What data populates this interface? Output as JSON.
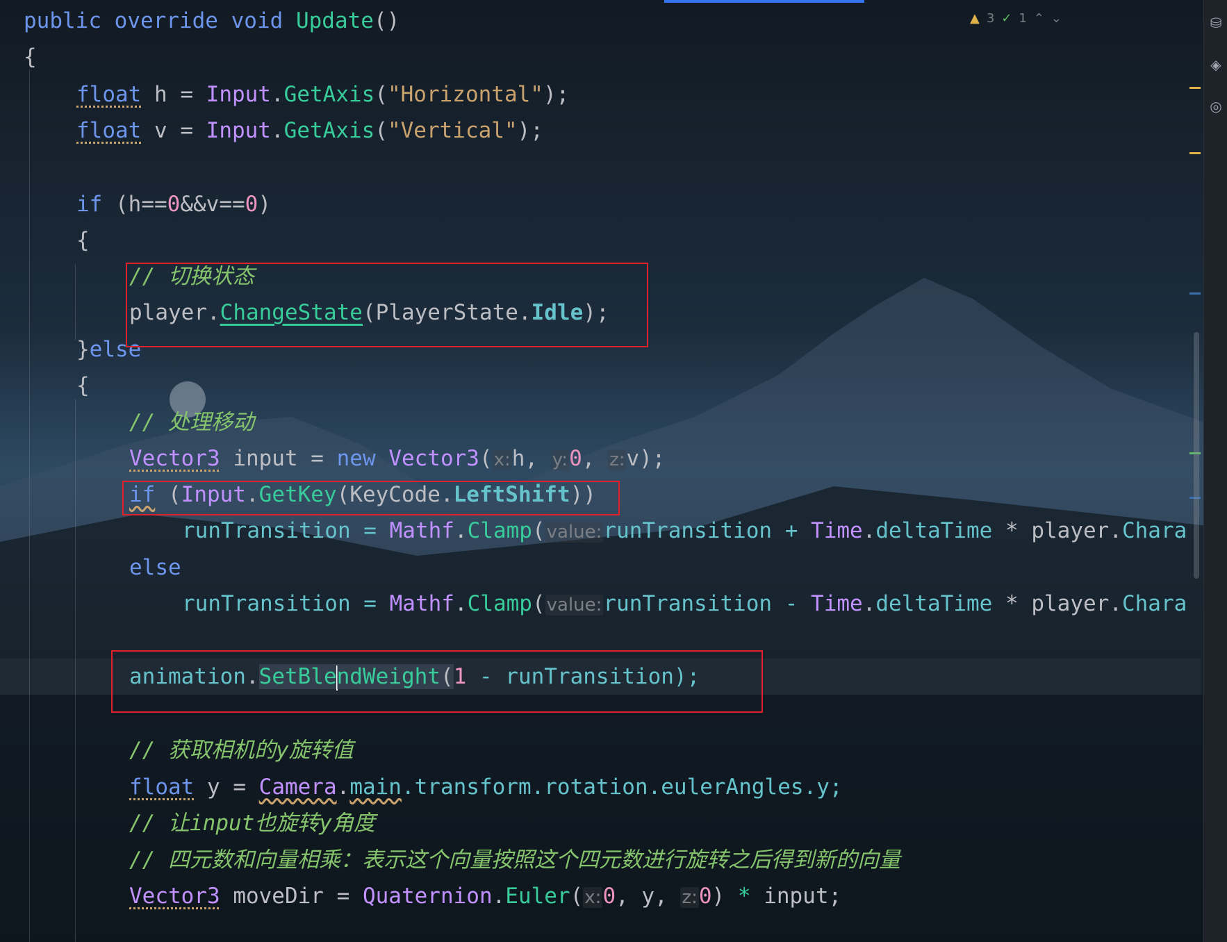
{
  "status": {
    "warnings": "3",
    "ok_count": "1",
    "up_arrow": "⌃",
    "down_arrow": "⌄"
  },
  "toolbar": {
    "icons": [
      "database-icon",
      "puzzle-icon",
      "coverage-icon"
    ]
  },
  "colors": {
    "highlight_box": "#e0202a",
    "keyword": "#6c95eb",
    "method": "#39cc9b",
    "comment": "#85c46c",
    "string": "#c9a26d",
    "number": "#ed94c0",
    "type": "#c191ff"
  },
  "code": {
    "l1_public": "public",
    "l1_override": "override",
    "l1_void": "void",
    "l1_name": "Update",
    "l1_parens": "()",
    "l2_brace": "{",
    "l3_float": "float",
    "l3_rest": " h = ",
    "l3_input": "Input",
    "l3_dot": ".",
    "l3_getaxis": "GetAxis",
    "l3_open": "(",
    "l3_str": "\"Horizontal\"",
    "l3_close": ");",
    "l4_float": "float",
    "l4_rest": " v = ",
    "l4_input": "Input",
    "l4_dot": ".",
    "l4_getaxis": "GetAxis",
    "l4_open": "(",
    "l4_str": "\"Vertical\"",
    "l4_close": ");",
    "l5_if": "if",
    "l5_a": " (h==",
    "l5_n1": "0",
    "l5_b": "&&v==",
    "l5_n2": "0",
    "l5_c": ")",
    "l6_brace": "{",
    "l7_comment": "// 切换状态",
    "l8_player": "player",
    "l8_dot": ".",
    "l8_method": "ChangeState",
    "l8_open": "(",
    "l8_enum": "PlayerState",
    "l8_dot2": ".",
    "l8_val": "Idle",
    "l8_close": ");",
    "l9_brace": "}",
    "l9_else": "else",
    "l10_brace": "{",
    "l11_comment": "// 处理移动",
    "l12_vec": "Vector3",
    "l12_a": " input = ",
    "l12_new": "new",
    "l12_sp": " ",
    "l12_vec2": "Vector3",
    "l12_open": "(",
    "l12_hx": "x:",
    "l12_h": "h, ",
    "l12_hy": "y:",
    "l12_zero": "0",
    "l12_comma": ", ",
    "l12_hz": "z:",
    "l12_v": "v);",
    "l13_if": "if",
    "l13_a": " (",
    "l13_input": "Input",
    "l13_dot": ".",
    "l13_getkey": "GetKey",
    "l13_open": "(",
    "l13_keycode": "KeyCode",
    "l13_dot2": ".",
    "l13_lshift": "LeftShift",
    "l13_close": "))",
    "l14_rt": "runTransition = ",
    "l14_mathf": "Mathf",
    "l14_dot": ".",
    "l14_clamp": "Clamp",
    "l14_open": "(",
    "l14_hint": "value:",
    "l14_rt2": "runTransition + ",
    "l14_time": "Time",
    "l14_dot2": ".",
    "l14_dt": "deltaTime",
    "l14_mul": " * player.",
    "l14_chara": "Chara",
    "l15_else": "else",
    "l16_rt": "runTransition = ",
    "l16_mathf": "Mathf",
    "l16_dot": ".",
    "l16_clamp": "Clamp",
    "l16_open": "(",
    "l16_hint": "value:",
    "l16_rt2": "runTransition - ",
    "l16_time": "Time",
    "l16_dot2": ".",
    "l16_dt": "deltaTime",
    "l16_mul": " * player.",
    "l16_chara": "Chara",
    "l17_anim": "animation",
    "l17_dot": ".",
    "l17_m1": "SetBle",
    "l17_m2": "ndWeight",
    "l17_open": "(",
    "l17_one": "1",
    "l17_rest": " - runTransition);",
    "l18_comment": "// 获取相机的y旋转值",
    "l19_float": "float",
    "l19_a": " y = ",
    "l19_camera": "Camera",
    "l19_dot": ".",
    "l19_main": "main",
    "l19_rest": ".transform.rotation.eulerAngles.y;",
    "l20_comment": "// 让input也旋转y角度",
    "l21_comment": "// 四元数和向量相乘：表示这个向量按照这个四元数进行旋转之后得到新的向量",
    "l22_vec": "Vector3",
    "l22_a": " moveDir = ",
    "l22_quat": "Quaternion",
    "l22_dot": ".",
    "l22_euler": "Euler",
    "l22_open": "(",
    "l22_hx": "x:",
    "l22_zero1": "0",
    "l22_mid": ", y, ",
    "l22_hz": "z:",
    "l22_zero2": "0",
    "l22_close": ") ",
    "l22_star": "*",
    "l22_end": " input;"
  }
}
